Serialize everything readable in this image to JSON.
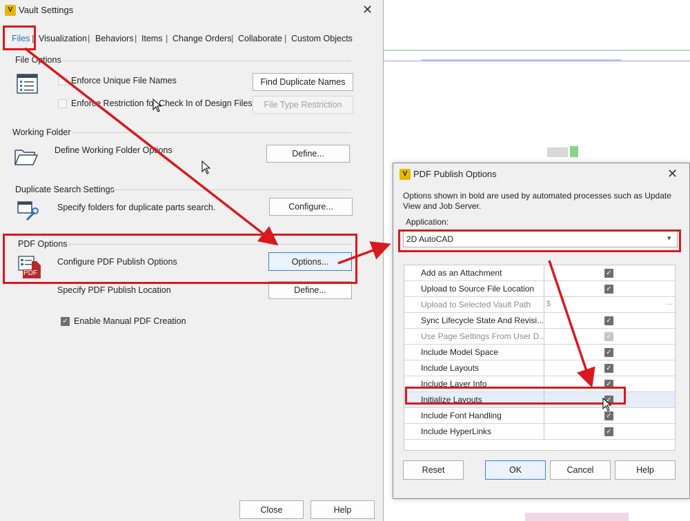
{
  "vault": {
    "title": "Vault Settings",
    "close_glyph": "✕",
    "tabs": [
      {
        "label": "Files"
      },
      {
        "label": "Visualization"
      },
      {
        "label": "Behaviors"
      },
      {
        "label": "Items"
      },
      {
        "label": "Change Orders"
      },
      {
        "label": "Collaborate"
      },
      {
        "label": "Custom Objects"
      }
    ],
    "tab_separator": "|",
    "file_options": {
      "title": "File Options",
      "enforce_unique": "Enforce Unique File Names",
      "enforce_restriction": "Enforce Restriction for Check In of Design Files",
      "find_duplicate_btn": "Find Duplicate Names",
      "file_type_btn": "File Type Restriction"
    },
    "working_folder": {
      "title": "Working Folder",
      "define_text": "Define Working Folder Options",
      "define_btn": "Define..."
    },
    "duplicate_search": {
      "title": "Duplicate Search Settings",
      "text": "Specify folders for duplicate parts search.",
      "configure_btn": "Configure..."
    },
    "pdf_options": {
      "title": "PDF Options",
      "configure_text": "Configure PDF Publish Options",
      "options_btn": "Options...",
      "location_text": "Specify PDF Publish Location",
      "define_btn": "Define...",
      "manual_creation": "Enable Manual PDF Creation",
      "pdf_icon_text": "PDF"
    },
    "footer": {
      "close_btn": "Close",
      "help_btn": "Help"
    }
  },
  "pdf_dialog": {
    "title": "PDF Publish Options",
    "close_glyph": "✕",
    "description": "Options shown in bold are used by automated processes such as Update View and Job Server.",
    "application_label": "Application:",
    "application_value": "2D AutoCAD",
    "dropdown_glyph": "▾",
    "rows": [
      {
        "label": "Add as an Attachment",
        "checked": true,
        "disabled": false
      },
      {
        "label": "Upload to Source File Location",
        "checked": true,
        "disabled": false
      },
      {
        "label": "Upload to Selected Vault Path",
        "value": "$",
        "ellipsis": "...",
        "disabled": true
      },
      {
        "label": "Sync Lifecycle State And Revisi...",
        "checked": true,
        "disabled": false
      },
      {
        "label": "Use Page Settings From User D...",
        "checked": true,
        "disabled": true
      },
      {
        "label": "Include Model Space",
        "checked": true,
        "disabled": false
      },
      {
        "label": "Include Layouts",
        "checked": true,
        "disabled": false
      },
      {
        "label": "Include Layer Info",
        "checked": true,
        "disabled": false
      },
      {
        "label": "Initialize Layouts",
        "checked": true,
        "disabled": false
      },
      {
        "label": "Include Font Handling",
        "checked": true,
        "disabled": false
      },
      {
        "label": "Include HyperLinks",
        "checked": true,
        "disabled": false
      }
    ],
    "check_glyph": "✓",
    "buttons": {
      "reset": "Reset",
      "ok": "OK",
      "cancel": "Cancel",
      "help": "Help"
    }
  },
  "colors": {
    "annotation_red": "#d9191e",
    "tab_active": "#2a6fc9",
    "vault_icon": "#e6b800"
  }
}
